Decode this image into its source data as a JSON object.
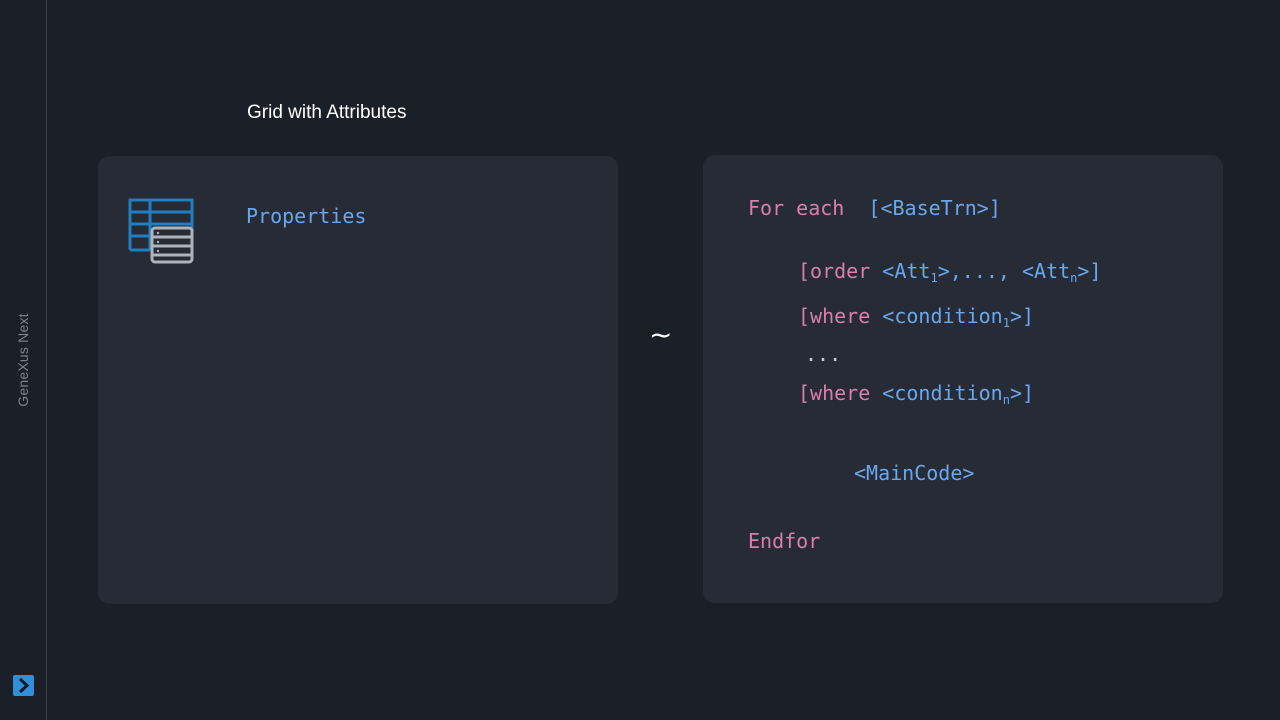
{
  "sidebar": {
    "brand": "GeneXus Next",
    "expand_icon": "chevron-right-icon",
    "accent": "#2f8fd8"
  },
  "slide": {
    "title": "Grid with Attributes",
    "left_panel": {
      "icon": "grid-icon",
      "label": "Properties"
    },
    "separator": "~",
    "code": {
      "for_each": "For each",
      "base_trn": "[<BaseTrn>]",
      "order_open": "[order",
      "order_att1": "<Att",
      "sub_1": "1",
      "order_mid": ">,...,",
      "order_attn": "<Att",
      "sub_n": "n",
      "order_close": ">]",
      "where1_kw": "[where",
      "where1_cond": "<condition",
      "where1_close": ">]",
      "ellipsis": "...",
      "wheren_kw": "[where",
      "wheren_cond": "<condition",
      "wheren_close": ">]",
      "main_code": "<MainCode>",
      "endfor": "Endfor"
    },
    "colors": {
      "keyword": "#d97fb0",
      "identifier": "#6aa8ee"
    }
  }
}
